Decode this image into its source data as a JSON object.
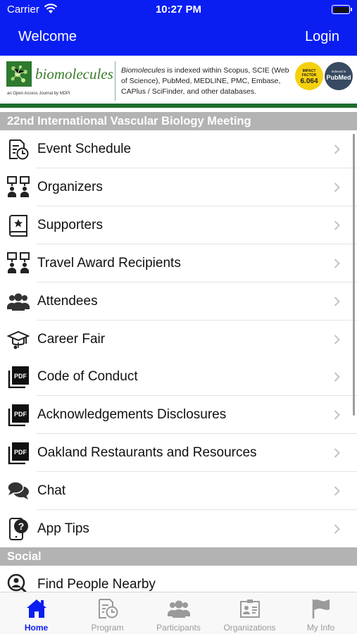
{
  "status_bar": {
    "carrier": "Carrier",
    "time": "10:27 PM"
  },
  "nav": {
    "title": "Welcome",
    "login": "Login"
  },
  "banner": {
    "logo_text": "biomolecules",
    "logo_subtitle": "an Open Access Journal by MDPI",
    "journal_name": "Biomolecules",
    "description": " is indexed within Scopus, SCIE (Web of Science), PubMed, MEDLINE, PMC, Embase, CAPlus / SciFinder, and other databases.",
    "impact_factor_label": "IMPACT FACTOR",
    "impact_factor_value": "6.064",
    "pubmed_label_top": "Indexed in",
    "pubmed_label": "PubMed"
  },
  "sections": [
    {
      "title": "22nd International Vascular Biology Meeting",
      "items": [
        {
          "label": "Event Schedule",
          "icon": "schedule-icon"
        },
        {
          "label": "Organizers",
          "icon": "organizers-icon"
        },
        {
          "label": "Supporters",
          "icon": "supporters-icon"
        },
        {
          "label": "Travel Award Recipients",
          "icon": "award-recipients-icon"
        },
        {
          "label": "Attendees",
          "icon": "attendees-icon"
        },
        {
          "label": "Career Fair",
          "icon": "graduation-cap-icon"
        },
        {
          "label": "Code of Conduct",
          "icon": "pdf-icon"
        },
        {
          "label": "Acknowledgements Disclosures",
          "icon": "pdf-icon"
        },
        {
          "label": "Oakland Restaurants and Resources",
          "icon": "pdf-icon"
        },
        {
          "label": "Chat",
          "icon": "chat-icon"
        },
        {
          "label": "App Tips",
          "icon": "help-icon"
        }
      ]
    },
    {
      "title": "Social",
      "items": [
        {
          "label": "Find People Nearby",
          "icon": "find-people-icon"
        }
      ]
    }
  ],
  "tabs": [
    {
      "label": "Home",
      "icon": "home-icon",
      "active": true
    },
    {
      "label": "Program",
      "icon": "program-icon",
      "active": false
    },
    {
      "label": "Participants",
      "icon": "participants-icon",
      "active": false
    },
    {
      "label": "Organizations",
      "icon": "organizations-icon",
      "active": false
    },
    {
      "label": "My Info",
      "icon": "flag-icon",
      "active": false
    }
  ],
  "colors": {
    "header_blue": "#0a1ef2",
    "section_gray": "#b3b3b3",
    "tab_active": "#0a1ef2",
    "tab_inactive": "#9a9a9a"
  }
}
